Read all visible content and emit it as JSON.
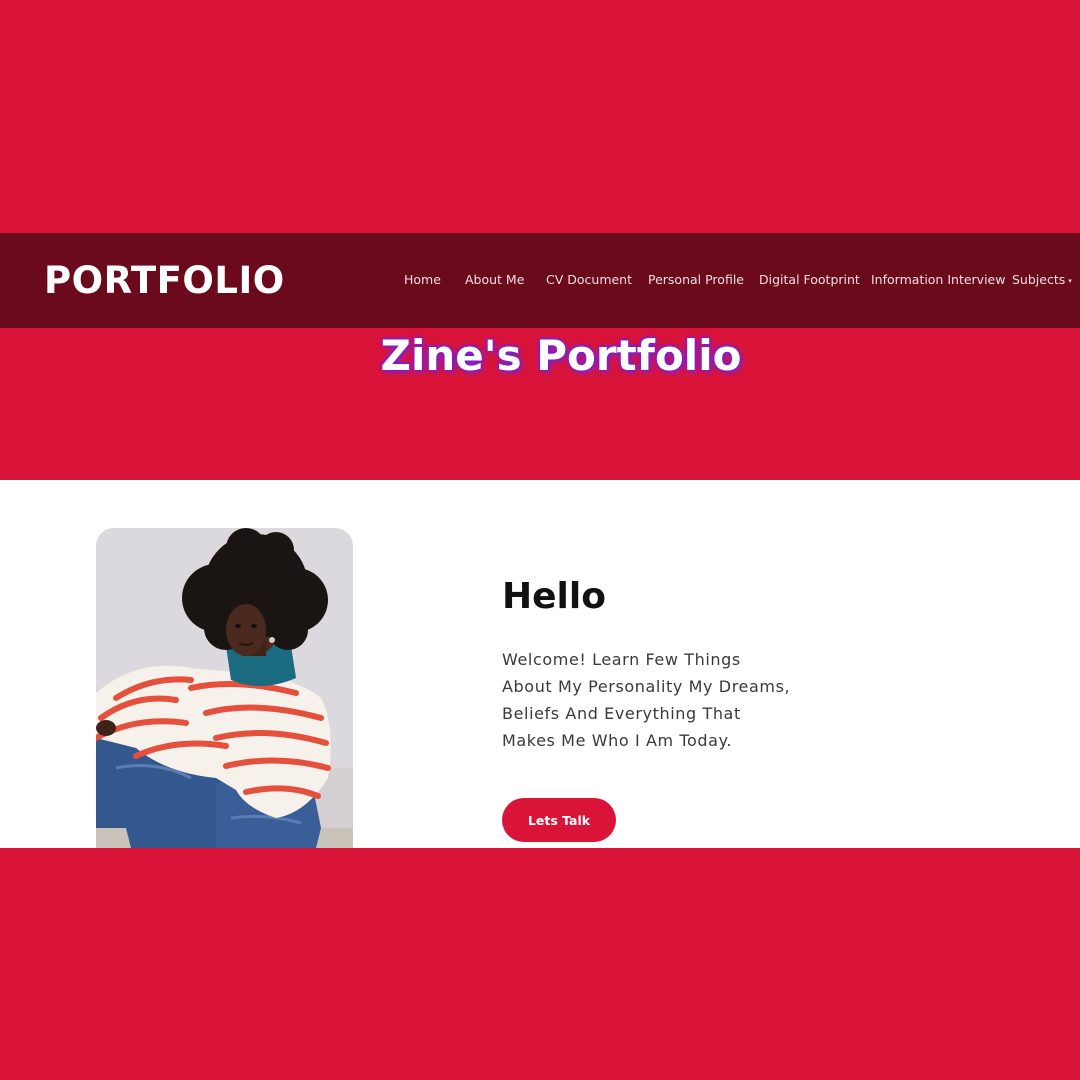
{
  "colors": {
    "background": "#da1439",
    "navbar": "#6b0a1c",
    "accent": "#da1439",
    "title_glow": "#7a20e0"
  },
  "navbar": {
    "brand": "PORTFOLIO",
    "items": [
      {
        "label": "Home"
      },
      {
        "label": "About Me"
      },
      {
        "label": "CV Document"
      },
      {
        "label": "Personal Profile"
      },
      {
        "label": "Digital Footprint"
      },
      {
        "label": "Information Interview"
      },
      {
        "label": "Subjects",
        "caret": "▾"
      }
    ]
  },
  "hero": {
    "title": "Zine's Portfolio"
  },
  "intro": {
    "heading": "Hello",
    "line1": "Welcome! Learn Few Things",
    "line2": "About My Personality My Dreams,",
    "line3": "Beliefs And Everything That",
    "line4": "Makes Me Who I Am Today.",
    "button_label": "Lets Talk"
  }
}
